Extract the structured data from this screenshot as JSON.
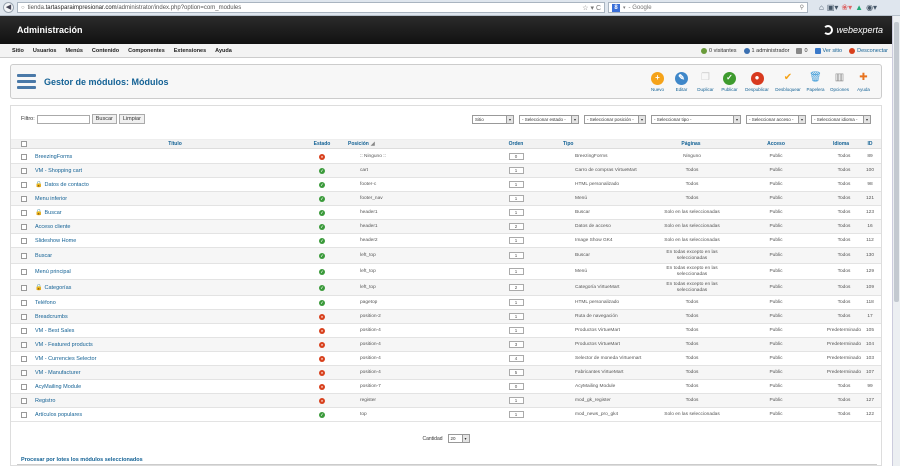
{
  "browser": {
    "url_prefix": "tienda.",
    "url_domain": "tartasparaimpresionar.com",
    "url_path": "/administrator/index.php?option=com_modules",
    "search_placeholder": "Google",
    "search_engine": "8"
  },
  "header": {
    "title": "Administración",
    "logo": "webexperta"
  },
  "menu": [
    "Sitio",
    "Usuarios",
    "Menús",
    "Contenido",
    "Componentes",
    "Extensiones",
    "Ayuda"
  ],
  "status": {
    "visitors": "0 visitantes",
    "admins": "1 administrador",
    "messages": "0",
    "view_site": "Ver sitio",
    "logout": "Desconectar"
  },
  "page_title": "Gestor de módulos: Módulos",
  "toolbar": [
    {
      "label": "Nuevo",
      "icon": "new-icon",
      "color": "#f5a31a",
      "glyph": "+"
    },
    {
      "label": "Editar",
      "icon": "edit-icon",
      "color": "#3f87c9",
      "glyph": "✎"
    },
    {
      "label": "Duplicar",
      "icon": "copy-icon",
      "color": "#cfcfcf",
      "glyph": "❐"
    },
    {
      "label": "Publicar",
      "icon": "publish-icon",
      "color": "#3e9b2e",
      "glyph": "✓"
    },
    {
      "label": "Despublicar",
      "icon": "unpublish-icon",
      "color": "#d83a1f",
      "glyph": "●"
    },
    {
      "label": "Desbloquear",
      "icon": "checkin-icon",
      "color": "#f5a31a",
      "glyph": "✔"
    },
    {
      "label": "Papelera",
      "icon": "trash-icon",
      "color": "#3f9bd8",
      "glyph": "🗑"
    },
    {
      "label": "Opciones",
      "icon": "options-icon",
      "color": "#888888",
      "glyph": "▥"
    },
    {
      "label": "Ayuda",
      "icon": "help-icon",
      "color": "#e8731f",
      "glyph": "✚"
    }
  ],
  "filter": {
    "label": "Filtro:",
    "search_button": "Buscar",
    "clear_button": "Limpiar",
    "selects": [
      "Sitio",
      "- Seleccionar estado -",
      "- Seleccionar posición -",
      "- Seleccionar tipo -",
      "- Seleccionar acceso -",
      "- Seleccionar idioma -"
    ]
  },
  "columns": [
    "Título",
    "Estado",
    "Posición",
    "Orden",
    "Tipo",
    "Páginas",
    "Acceso",
    "Idioma",
    "ID"
  ],
  "rows": [
    {
      "title": "BreezingForms",
      "locked": false,
      "status": "off",
      "position": ":: Ninguno ::",
      "order": "0",
      "type": "BreezingForms",
      "pages": "Ninguno",
      "access": "Public",
      "language": "Todos",
      "id": "89"
    },
    {
      "title": "VM - Shopping cart",
      "locked": false,
      "status": "on",
      "position": "cart",
      "order": "1",
      "type": "Carro de compras VirtueMart",
      "pages": "Todos",
      "access": "Public",
      "language": "Todos",
      "id": "100"
    },
    {
      "title": "Datos de contacto",
      "locked": true,
      "status": "on",
      "position": "footer-c",
      "order": "1",
      "type": "HTML personalizado",
      "pages": "Todos",
      "access": "Public",
      "language": "Todos",
      "id": "98"
    },
    {
      "title": "Menu inferior",
      "locked": false,
      "status": "on",
      "position": "footer_nav",
      "order": "1",
      "type": "Menú",
      "pages": "Todos",
      "access": "Public",
      "language": "Todos",
      "id": "121"
    },
    {
      "title": "Buscar",
      "locked": true,
      "status": "on",
      "position": "header1",
      "order": "1",
      "type": "Buscar",
      "pages": "Solo en las seleccionadas",
      "access": "Public",
      "language": "Todos",
      "id": "123"
    },
    {
      "title": "Acceso cliente",
      "locked": false,
      "status": "on",
      "position": "header1",
      "order": "2",
      "type": "Datos de acceso",
      "pages": "Solo en las seleccionadas",
      "access": "Public",
      "language": "Todos",
      "id": "16"
    },
    {
      "title": "Slideshow Home",
      "locked": false,
      "status": "on",
      "position": "header2",
      "order": "1",
      "type": "Image Show GK4",
      "pages": "Solo en las seleccionadas",
      "access": "Public",
      "language": "Todos",
      "id": "112"
    },
    {
      "title": "Buscar",
      "locked": false,
      "status": "on",
      "position": "left_top",
      "order": "1",
      "type": "Buscar",
      "pages": "En todas excepto en las seleccionadas",
      "access": "Public",
      "language": "Todos",
      "id": "130"
    },
    {
      "title": "Menú principal",
      "locked": false,
      "status": "on",
      "position": "left_top",
      "order": "1",
      "type": "Menú",
      "pages": "En todas excepto en las seleccionadas",
      "access": "Public",
      "language": "Todos",
      "id": "129"
    },
    {
      "title": "Categorías",
      "locked": true,
      "status": "on",
      "position": "left_top",
      "order": "2",
      "type": "Categoría VirtueMart",
      "pages": "En todas excepto en las seleccionadas",
      "access": "Public",
      "language": "Todos",
      "id": "109"
    },
    {
      "title": "Teléfono",
      "locked": false,
      "status": "on",
      "position": "pagetop",
      "order": "1",
      "type": "HTML personalizado",
      "pages": "Todos",
      "access": "Public",
      "language": "Todos",
      "id": "118"
    },
    {
      "title": "Breadcrumbs",
      "locked": false,
      "status": "off",
      "position": "position-2",
      "order": "1",
      "type": "Ruta de navegación",
      "pages": "Todos",
      "access": "Public",
      "language": "Todos",
      "id": "17"
    },
    {
      "title": "VM - Best Sales",
      "locked": false,
      "status": "off",
      "position": "position-4",
      "order": "1",
      "type": "Productos VirtueMart",
      "pages": "Todos",
      "access": "Public",
      "language": "Predeterminado",
      "id": "105"
    },
    {
      "title": "VM - Featured products",
      "locked": false,
      "status": "off",
      "position": "position-4",
      "order": "3",
      "type": "Productos VirtueMart",
      "pages": "Todos",
      "access": "Public",
      "language": "Predeterminado",
      "id": "104"
    },
    {
      "title": "VM - Currencies Selector",
      "locked": false,
      "status": "off",
      "position": "position-4",
      "order": "4",
      "type": "Selector de moneda Virtuemart",
      "pages": "Todos",
      "access": "Public",
      "language": "Predeterminado",
      "id": "103"
    },
    {
      "title": "VM - Manufacturer",
      "locked": false,
      "status": "off",
      "position": "position-4",
      "order": "5",
      "type": "Fabricantes VirtueMart",
      "pages": "Todos",
      "access": "Public",
      "language": "Predeterminado",
      "id": "107"
    },
    {
      "title": "AcyMailing Module",
      "locked": false,
      "status": "off",
      "position": "position-7",
      "order": "0",
      "type": "AcyMailing Module",
      "pages": "Todos",
      "access": "Public",
      "language": "Todos",
      "id": "99"
    },
    {
      "title": "Registro",
      "locked": false,
      "status": "off",
      "position": "register",
      "order": "1",
      "type": "mod_gk_register",
      "pages": "Todos",
      "access": "Public",
      "language": "Todos",
      "id": "127"
    },
    {
      "title": "Artículos populares",
      "locked": false,
      "status": "on",
      "position": "top",
      "order": "1",
      "type": "mod_news_pro_gk4",
      "pages": "Solo en las seleccionadas",
      "access": "Public",
      "language": "Todos",
      "id": "122"
    }
  ],
  "pagination": {
    "label": "Cantidad",
    "value": "20"
  },
  "batch_title": "Procesar por lotes los módulos seleccionados"
}
